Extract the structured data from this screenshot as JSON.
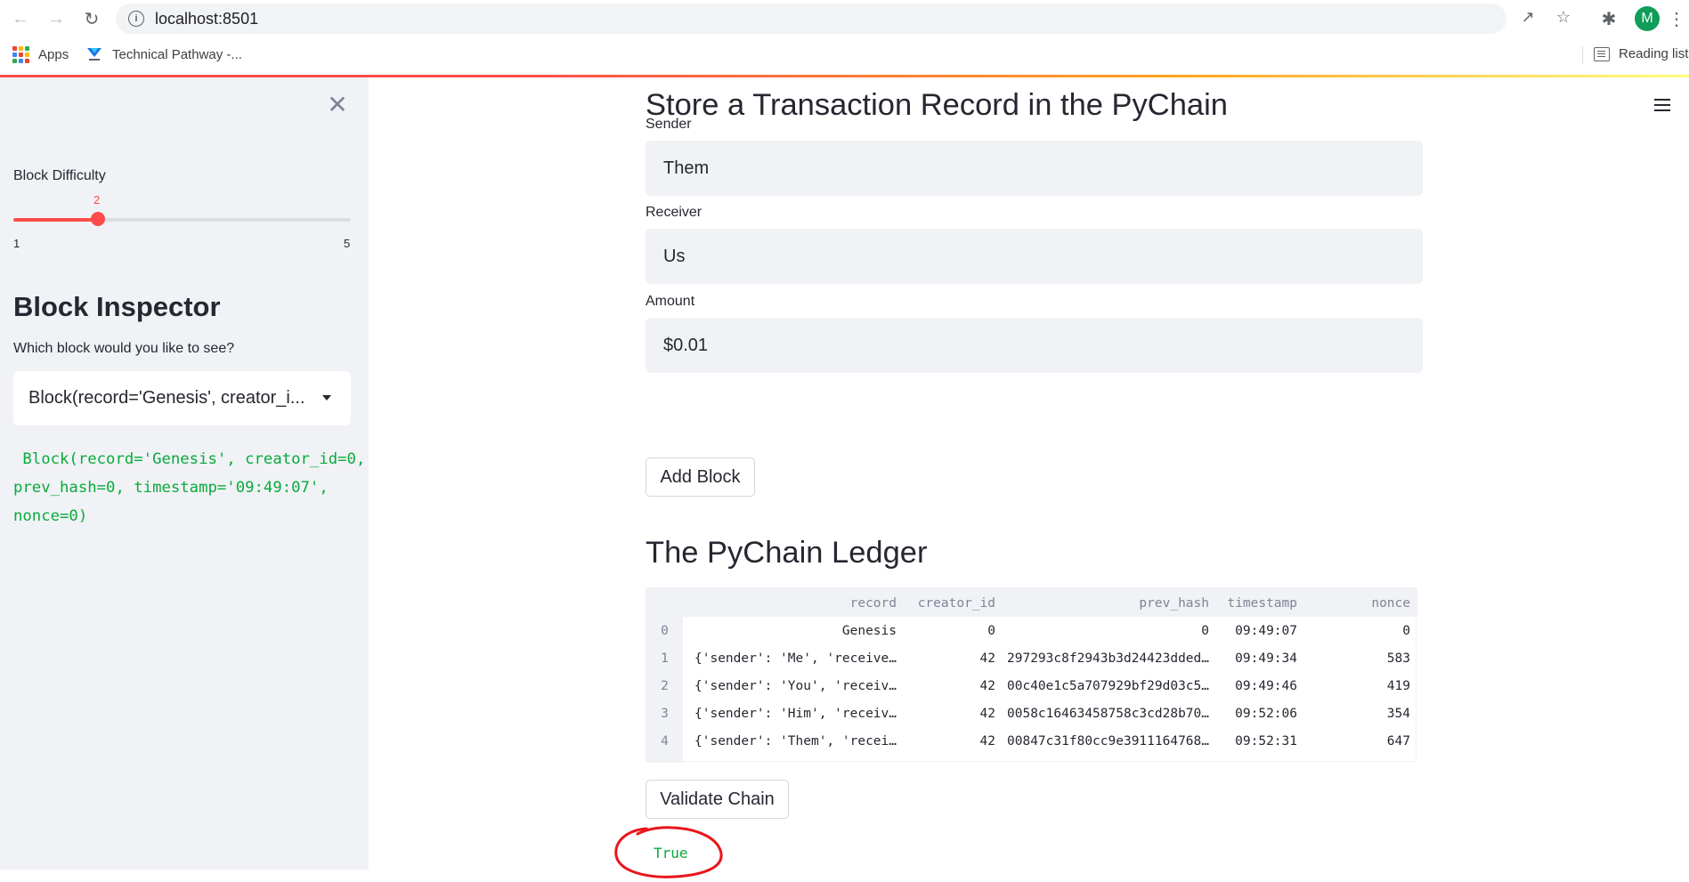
{
  "browser": {
    "url": "localhost:8501",
    "avatar_letter": "M",
    "bookmarks": [
      {
        "label": "Apps"
      },
      {
        "label": "Technical Pathway -..."
      }
    ],
    "reading_list": "Reading list"
  },
  "sidebar": {
    "slider": {
      "label": "Block Difficulty",
      "value": "2",
      "min": "1",
      "max": "5",
      "fraction": 0.25
    },
    "inspector_title": "Block Inspector",
    "inspector_question": "Which block would you like to see?",
    "select_value": "Block(record='Genesis', creator_i...",
    "block_code": " Block(record='Genesis', creator_id=0,\nprev_hash=0, timestamp='09:49:07',\nnonce=0)"
  },
  "main": {
    "title": "Store a Transaction Record in the PyChain",
    "fields": [
      {
        "label": "Sender",
        "value": "Them"
      },
      {
        "label": "Receiver",
        "value": "Us"
      },
      {
        "label": "Amount",
        "value": "$0.01"
      }
    ],
    "add_button": "Add Block",
    "ledger_title": "The PyChain Ledger",
    "table": {
      "columns": [
        "record",
        "creator_id",
        "prev_hash",
        "timestamp",
        "nonce"
      ],
      "rows": [
        {
          "index": "0",
          "record": "Genesis",
          "creator_id": "0",
          "prev_hash": "0",
          "timestamp": "09:49:07",
          "nonce": "0"
        },
        {
          "index": "1",
          "record": "{'sender': 'Me', 'receive…",
          "creator_id": "42",
          "prev_hash": "297293c8f2943b3d24423dded…",
          "timestamp": "09:49:34",
          "nonce": "583"
        },
        {
          "index": "2",
          "record": "{'sender': 'You', 'receiv…",
          "creator_id": "42",
          "prev_hash": "00c40e1c5a707929bf29d03c5…",
          "timestamp": "09:49:46",
          "nonce": "419"
        },
        {
          "index": "3",
          "record": "{'sender': 'Him', 'receiv…",
          "creator_id": "42",
          "prev_hash": "0058c16463458758c3cd28b70…",
          "timestamp": "09:52:06",
          "nonce": "354"
        },
        {
          "index": "4",
          "record": "{'sender': 'Them', 'recei…",
          "creator_id": "42",
          "prev_hash": "00847c31f80cc9e3911164768…",
          "timestamp": "09:52:31",
          "nonce": "647"
        }
      ]
    },
    "validate_button": "Validate Chain",
    "validate_result": "True"
  },
  "colors": {
    "accent": "#ff4b4b",
    "success_text": "#09ab3b",
    "sidebar_bg": "#f0f2f6",
    "annotation": "#e8151b"
  }
}
